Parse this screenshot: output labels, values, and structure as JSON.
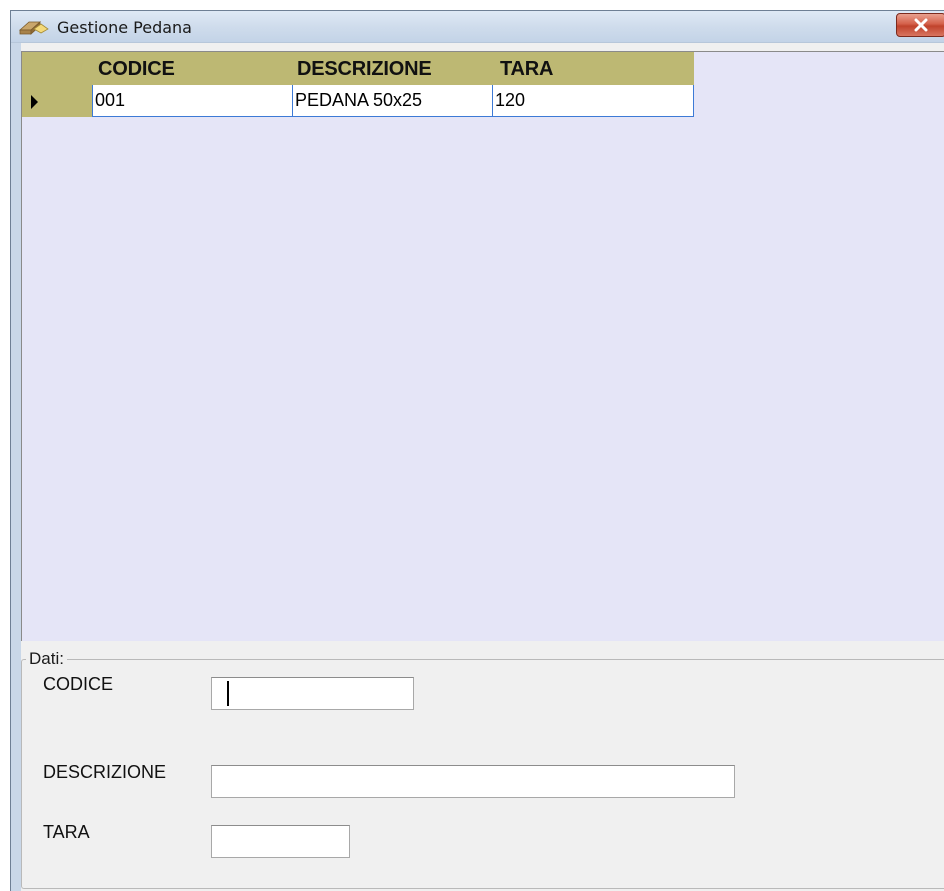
{
  "window": {
    "title": "Gestione Pedana"
  },
  "grid": {
    "columns": [
      "CODICE",
      "DESCRIZIONE",
      "TARA"
    ],
    "rows": [
      {
        "codice": "001",
        "descrizione": "PEDANA 50x25",
        "tara": "120"
      }
    ]
  },
  "form": {
    "group_title": "Dati:",
    "codice_label": "CODICE",
    "codice_value": "",
    "descrizione_label": "DESCRIZIONE",
    "descrizione_value": "",
    "tara_label": "TARA",
    "tara_value": ""
  },
  "colors": {
    "header_bg": "#bdb873",
    "grid_bg": "#e5e5f7",
    "selection_border": "#3d7ad6"
  },
  "icons": {
    "app_icon": "pallet-icon",
    "close_icon": "close-icon",
    "row_indicator": "row-selector-arrow-icon"
  }
}
